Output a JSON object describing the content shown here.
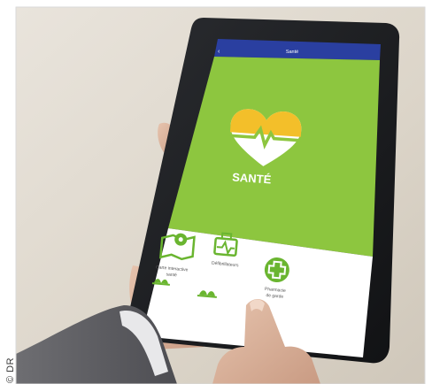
{
  "photo_credit": "© DR",
  "app": {
    "title": "Santé",
    "heading": "SANTÉ",
    "accent_color": "#8dc63f",
    "header_color": "#2a3fa0",
    "heart_yellow": "#f3bf2a",
    "icon_green": "#6ab530"
  },
  "menu": [
    {
      "label_line1": "Carte interactive",
      "label_line2": "santé",
      "icon": "map-pin-icon"
    },
    {
      "label_line1": "Défibrillateurs",
      "label_line2": "",
      "icon": "defibrillator-icon"
    },
    {
      "label_line1": "Pharmacie",
      "label_line2": "de garde",
      "icon": "medical-cross-icon"
    }
  ],
  "bottom_row_icons": [
    "leaf-icon",
    "leaf-icon"
  ]
}
